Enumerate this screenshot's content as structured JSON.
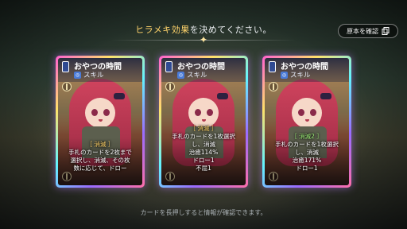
{
  "header": {
    "prefix": "ヒラメキ効果",
    "suffix": "を決めてください。"
  },
  "original_button": {
    "label": "原本を確認",
    "icon": "card-stack-icon"
  },
  "cards": [
    {
      "name": "おやつの時間",
      "type": "スキル",
      "tag": "［ 消滅 ］",
      "lines": [
        "手札のカードを2枚まで",
        "選択し、消滅、その枚",
        "数に応じて、ドロー"
      ]
    },
    {
      "name": "おやつの時間",
      "type": "スキル",
      "tag": "［ 消滅 ］",
      "lines": [
        "手札のカードを1枚選択",
        "し、消滅",
        "治癒114%",
        "ドロー1",
        "不屈1"
      ]
    },
    {
      "name": "おやつの時間",
      "type": "スキル",
      "tag": "［ 消滅2 ］",
      "lines": [
        "手札のカードを1枚選択",
        "し、消滅",
        "治癒171%",
        "ドロー1"
      ]
    }
  ],
  "footer": {
    "hint": "カードを長押しすると情報が確認できます。"
  },
  "colors": {
    "accent": "#ffd36b",
    "tag_upgraded": "#9ff07a"
  }
}
